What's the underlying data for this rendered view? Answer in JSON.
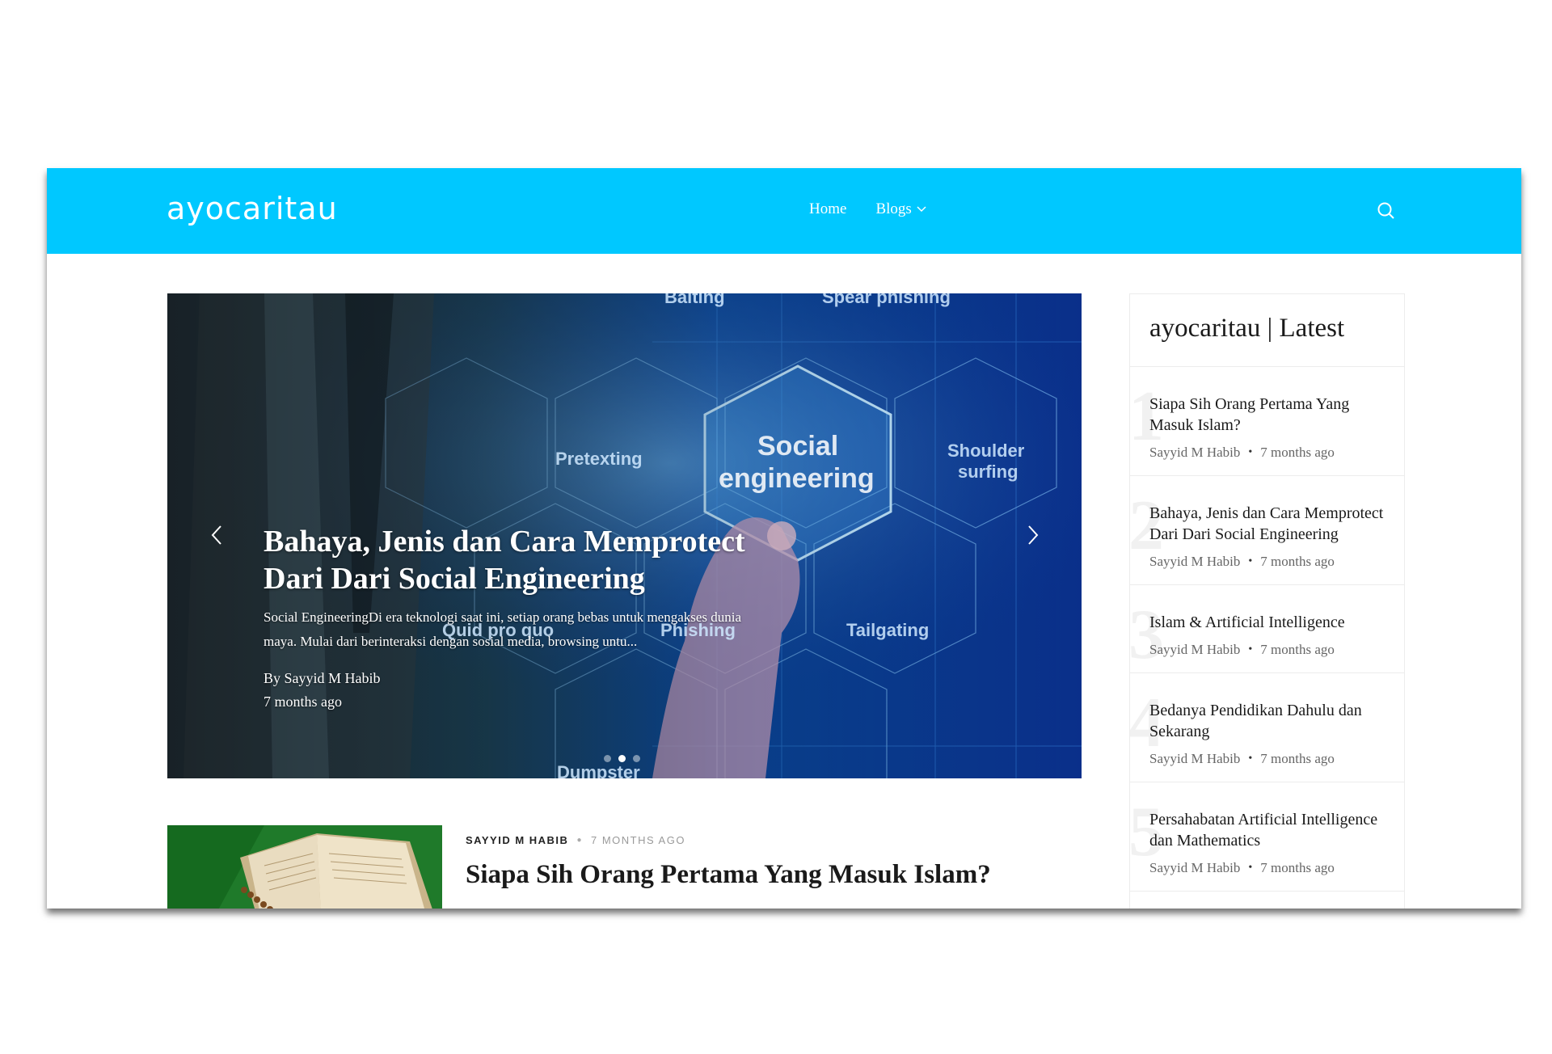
{
  "site": {
    "logo": "ayocaritau",
    "brand_color": "#00c8ff"
  },
  "nav": {
    "items": [
      {
        "label": "Home"
      },
      {
        "label": "Blogs"
      }
    ],
    "search_icon": "search-icon"
  },
  "hero": {
    "title": "Bahaya, Jenis dan Cara Memprotect Dari Dari Social Engineering",
    "excerpt": "Social EngineeringDi era teknologi saat ini, setiap orang bebas untuk mengakses dunia maya. Mulai dari berinteraksi dengan sosial media, browsing untu...",
    "author": "By Sayyid M Habib",
    "time": "7 months ago",
    "image_labels": {
      "center": "Social engineering",
      "items": [
        "Baiting",
        "Spear phishing",
        "Pretexting",
        "Shoulder surfing",
        "Quid pro quo",
        "Phishing",
        "Tailgating",
        "Dumpster"
      ]
    },
    "slides_total": 3,
    "slide_active": 2
  },
  "post": {
    "author": "SAYYID M HABIB",
    "time": "7 MONTHS AGO",
    "title": "Siapa Sih Orang Pertama Yang Masuk Islam?"
  },
  "sidebar": {
    "title": "ayocaritau | Latest",
    "items": [
      {
        "num": "1",
        "title": "Siapa Sih Orang Pertama Yang Masuk Islam?",
        "author": "Sayyid M Habib",
        "time": "7 months ago"
      },
      {
        "num": "2",
        "title": "Bahaya, Jenis dan Cara Memprotect Dari Dari Social Engineering",
        "author": "Sayyid M Habib",
        "time": "7 months ago"
      },
      {
        "num": "3",
        "title": "Islam & Artificial Intelligence",
        "author": "Sayyid M Habib",
        "time": "7 months ago"
      },
      {
        "num": "4",
        "title": "Bedanya Pendidikan Dahulu dan Sekarang",
        "author": "Sayyid M Habib",
        "time": "7 months ago"
      },
      {
        "num": "5",
        "title": "Persahabatan Artificial Intelligence dan Mathematics",
        "author": "Sayyid M Habib",
        "time": "7 months ago"
      }
    ]
  }
}
